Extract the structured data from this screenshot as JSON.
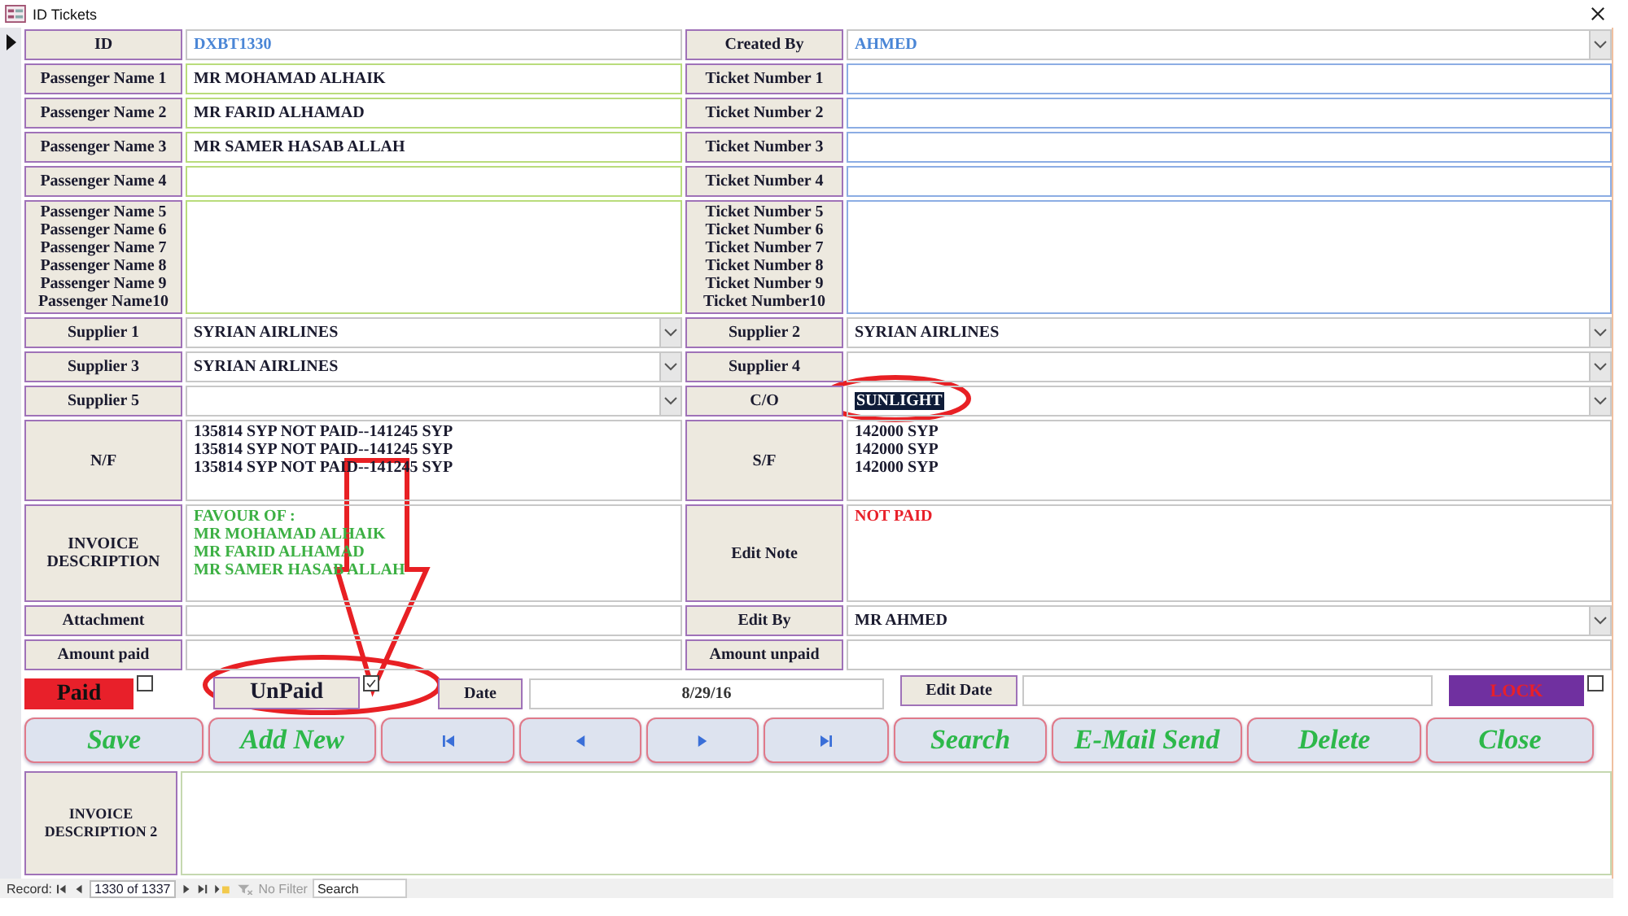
{
  "window": {
    "title": "ID Tickets"
  },
  "rows": [
    {
      "left": {
        "label": "ID",
        "kind": "text",
        "value": "DXBT1330",
        "color": "#4a86d6"
      },
      "right": {
        "label": "Created By",
        "kind": "combo",
        "value": "AHMED",
        "color": "#4a86d6"
      }
    },
    {
      "left": {
        "label": "Passenger Name 1",
        "kind": "text",
        "value": "MR MOHAMAD ALHAIK"
      },
      "right": {
        "label": "Ticket Number 1",
        "kind": "text"
      }
    },
    {
      "left": {
        "label": "Passenger Name 2",
        "kind": "text",
        "value": "MR FARID ALHAMAD"
      },
      "right": {
        "label": "Ticket Number 2",
        "kind": "text"
      }
    },
    {
      "left": {
        "label": "Passenger Name 3",
        "kind": "text",
        "value": "MR SAMER HASAB ALLAH"
      },
      "right": {
        "label": "Ticket Number 3",
        "kind": "text"
      }
    },
    {
      "left": {
        "label": "Passenger Name 4",
        "kind": "text"
      },
      "right": {
        "label": "Ticket Number 4",
        "kind": "text"
      }
    },
    {
      "left": {
        "label": "Passenger Name 5\nPassenger Name 6\nPassenger Name 7\nPassenger Name 8\nPassenger Name 9\nPassenger Name10",
        "kind": "memo"
      },
      "right": {
        "label": "Ticket Number 5\nTicket Number 6\nTicket Number 7\nTicket Number 8\nTicket Number 9\nTicket Number10",
        "kind": "memo"
      }
    },
    {
      "left": {
        "label": "Supplier 1",
        "kind": "combo",
        "value": "SYRIAN AIRLINES"
      },
      "right": {
        "label": "Supplier 2",
        "kind": "combo",
        "value": "SYRIAN AIRLINES"
      }
    },
    {
      "left": {
        "label": "Supplier 3",
        "kind": "combo",
        "value": "SYRIAN AIRLINES"
      },
      "right": {
        "label": "Supplier 4",
        "kind": "combo"
      }
    },
    {
      "left": {
        "label": "Supplier 5",
        "kind": "combo"
      },
      "right": {
        "label": "C/O",
        "kind": "combo",
        "value": "SUNLIGHT",
        "selected": true
      }
    },
    {
      "left": {
        "label": "N/F",
        "kind": "memo",
        "value": "135814 SYP  NOT PAID--141245 SYP\n135814 SYP  NOT PAID--141245 SYP\n135814 SYP NOT PAID--141245 SYP"
      },
      "right": {
        "label": "S/F",
        "kind": "memo",
        "value": "142000 SYP\n142000 SYP\n142000 SYP"
      }
    },
    {
      "left": {
        "label": "INVOICE\nDESCRIPTION",
        "kind": "memo",
        "value": "FAVOUR OF :\nMR MOHAMAD ALHAIK\nMR FARID ALHAMAD\nMR SAMER HASAB ALLAH",
        "color": "#3cb043"
      },
      "right": {
        "label": "Edit Note",
        "kind": "memo",
        "value": "NOT PAID",
        "color": "#e8202a"
      }
    },
    {
      "left": {
        "label": "Attachment",
        "kind": "text"
      },
      "right": {
        "label": "Edit By",
        "kind": "combo",
        "value": "MR AHMED"
      }
    },
    {
      "left": {
        "label": "Amount paid",
        "kind": "text"
      },
      "right": {
        "label": "Amount unpaid",
        "kind": "text"
      }
    }
  ],
  "paid": {
    "label": "Paid",
    "checked": false
  },
  "unpaid": {
    "label": "UnPaid",
    "checked": true
  },
  "date": {
    "label": "Date",
    "value": "8/29/16"
  },
  "edit_date": {
    "label": "Edit Date"
  },
  "lock": {
    "label": "LOCK",
    "checked": false
  },
  "buttons": [
    {
      "kind": "text",
      "label": "Save"
    },
    {
      "kind": "text",
      "label": "Add New"
    },
    {
      "kind": "first"
    },
    {
      "kind": "prev"
    },
    {
      "kind": "next"
    },
    {
      "kind": "last"
    },
    {
      "kind": "text",
      "label": "Search"
    },
    {
      "kind": "text",
      "label": "E-Mail Send"
    },
    {
      "kind": "text",
      "label": "Delete"
    },
    {
      "kind": "text",
      "label": "Close"
    }
  ],
  "invoice_description_2": {
    "label": "INVOICE\nDESCRIPTION 2"
  },
  "status_bar": {
    "record_label": "Record:",
    "position": "1330 of 1337",
    "filter": "No Filter",
    "search_placeholder": "Search"
  }
}
